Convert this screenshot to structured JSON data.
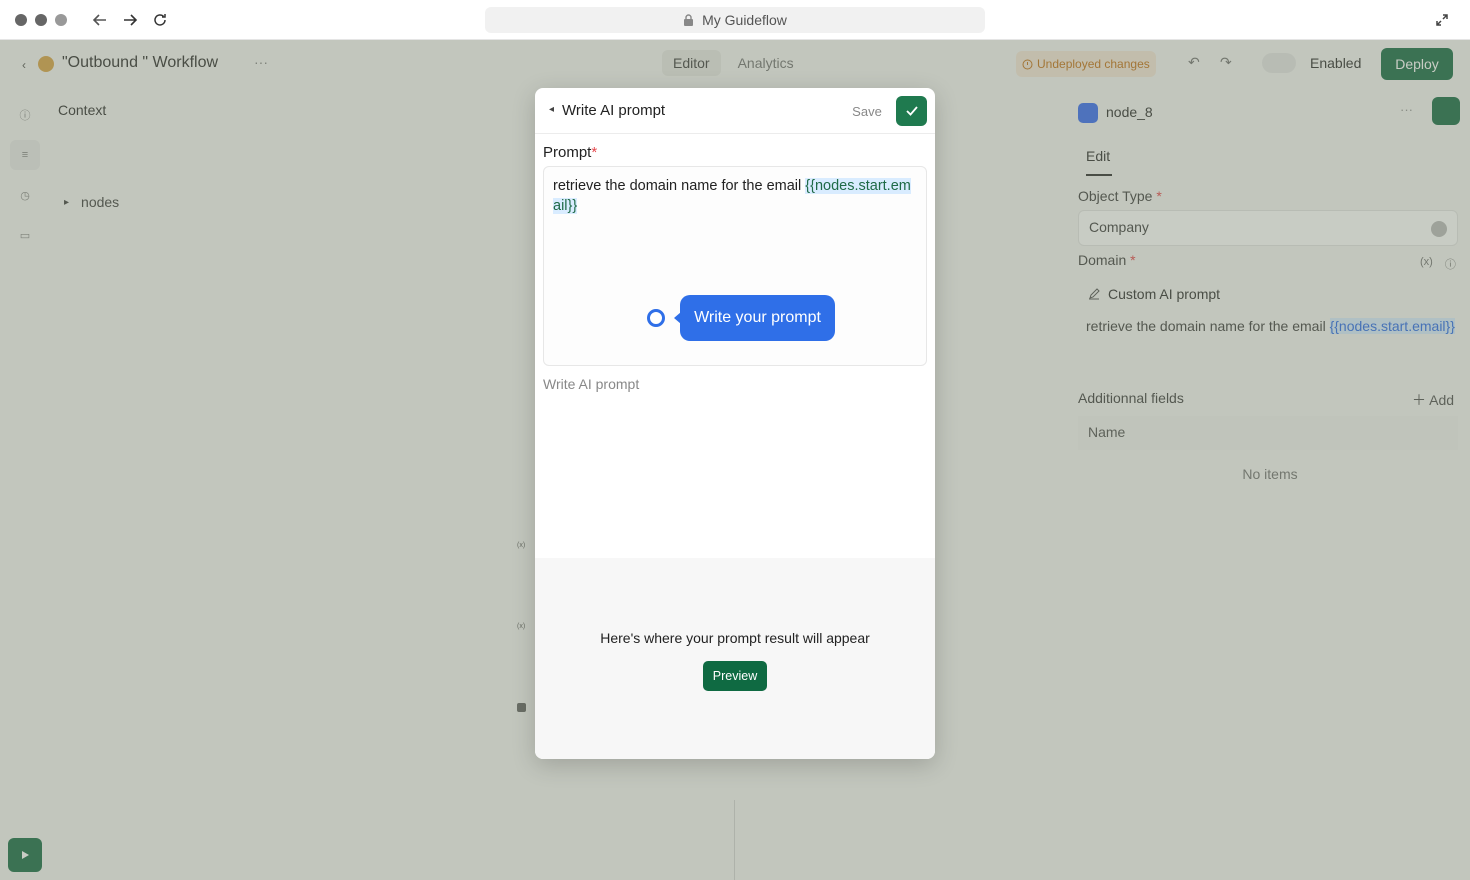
{
  "browser": {
    "url_title": "My Guideflow"
  },
  "app": {
    "workflow_title": "\"Outbound \" Workflow",
    "more_label": "···",
    "tabs": [
      {
        "label": "Editor"
      },
      {
        "label": "Analytics"
      }
    ],
    "undeployed_label": "Undeployed changes",
    "enabled_label": "Enabled",
    "deploy_label": "Deploy",
    "context_title": "Context",
    "tree_item": "nodes"
  },
  "right_panel": {
    "node_name": "node_8",
    "tab_edit": "Edit",
    "object_type_label": "Object Type",
    "object_type_value": "Company",
    "domain_label": "Domain",
    "domain_badge": "(x)",
    "custom_ai_label": "Custom AI prompt",
    "ai_text_prefix": "retrieve the domain name for the email ",
    "ai_text_var": "{{nodes.start.email}}",
    "additional_fields_label": "Additionnal fields",
    "add_label": "Add",
    "name_column": "Name",
    "no_items": "No items"
  },
  "modal": {
    "title": "Write AI prompt",
    "save_label": "Save",
    "prompt_label": "Prompt",
    "required_mark": "*",
    "prompt_text_prefix": "retrieve the domain name for the email ",
    "prompt_text_var": "{{nodes.start.email}}",
    "hint_bubble": "Write your prompt",
    "sub_label": "Write AI prompt",
    "result_placeholder": "Here's where your prompt result will appear",
    "preview_label": "Preview"
  },
  "colors": {
    "accent_green": "#1f7a4f",
    "hint_blue": "#2f6fe8",
    "required_red": "#e5484d"
  }
}
